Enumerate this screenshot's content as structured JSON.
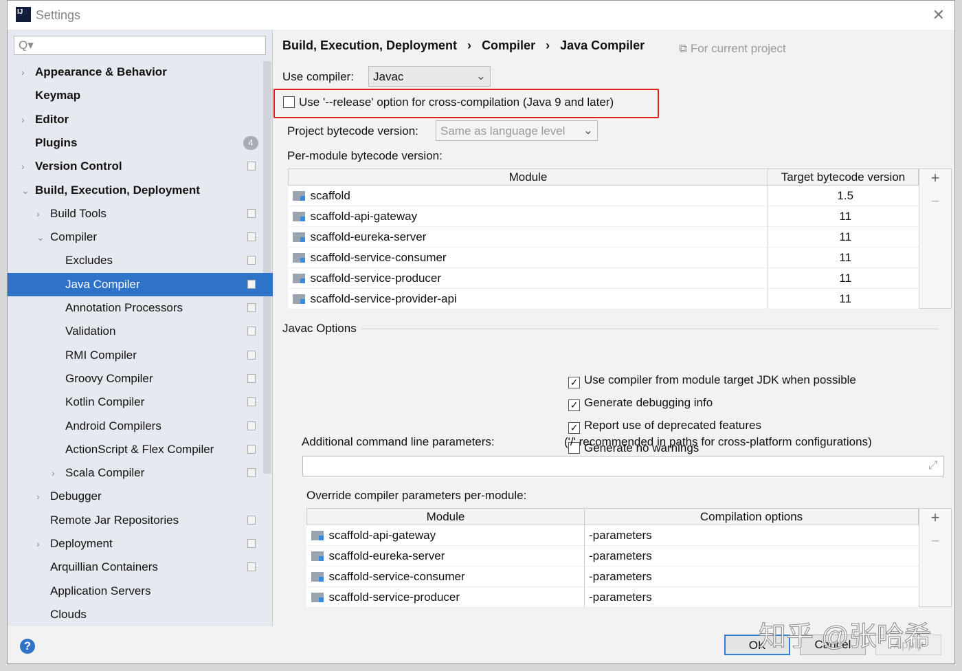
{
  "window": {
    "title": "Settings",
    "close": "✕"
  },
  "sidebar": {
    "search_placeholder": "Q▾",
    "items": [
      {
        "label": "Appearance & Behavior",
        "level": 0,
        "arrow": "›",
        "bold": true
      },
      {
        "label": "Keymap",
        "level": 0,
        "bold": true
      },
      {
        "label": "Editor",
        "level": 0,
        "arrow": "›",
        "bold": true
      },
      {
        "label": "Plugins",
        "level": 0,
        "bold": true,
        "badge": "4"
      },
      {
        "label": "Version Control",
        "level": 0,
        "arrow": "›",
        "bold": true,
        "icon": true
      },
      {
        "label": "Build, Execution, Deployment",
        "level": 0,
        "arrow": "⌄",
        "bold": true
      },
      {
        "label": "Build Tools",
        "level": 1,
        "arrow": "›",
        "icon": true
      },
      {
        "label": "Compiler",
        "level": 1,
        "arrow": "⌄",
        "icon": true
      },
      {
        "label": "Excludes",
        "level": 2,
        "icon": true
      },
      {
        "label": "Java Compiler",
        "level": 2,
        "icon": true,
        "selected": true
      },
      {
        "label": "Annotation Processors",
        "level": 2,
        "icon": true
      },
      {
        "label": "Validation",
        "level": 2,
        "icon": true
      },
      {
        "label": "RMI Compiler",
        "level": 2,
        "icon": true
      },
      {
        "label": "Groovy Compiler",
        "level": 2,
        "icon": true
      },
      {
        "label": "Kotlin Compiler",
        "level": 2,
        "icon": true
      },
      {
        "label": "Android Compilers",
        "level": 2,
        "icon": true
      },
      {
        "label": "ActionScript & Flex Compiler",
        "level": 2,
        "icon": true
      },
      {
        "label": "Scala Compiler",
        "level": 2,
        "arrow": "›",
        "icon": true
      },
      {
        "label": "Debugger",
        "level": 1,
        "arrow": "›"
      },
      {
        "label": "Remote Jar Repositories",
        "level": 1,
        "icon": true
      },
      {
        "label": "Deployment",
        "level": 1,
        "arrow": "›",
        "icon": true
      },
      {
        "label": "Arquillian Containers",
        "level": 1,
        "icon": true
      },
      {
        "label": "Application Servers",
        "level": 1
      },
      {
        "label": "Clouds",
        "level": 1
      }
    ]
  },
  "main": {
    "breadcrumb": [
      "Build, Execution, Deployment",
      "Compiler",
      "Java Compiler"
    ],
    "breadcrumb_sep": "›",
    "scope": "For current project",
    "use_compiler_label": "Use compiler:",
    "use_compiler_value": "Javac",
    "release_option": "Use '--release' option for cross-compilation (Java 9 and later)",
    "release_checked": false,
    "highlight_color": "#e02020",
    "bytecode_label": "Project bytecode version:",
    "bytecode_value": "Same as language level",
    "per_module_label": "Per-module bytecode version:",
    "module_table": {
      "headers": [
        "Module",
        "Target bytecode version"
      ],
      "rows": [
        [
          "scaffold",
          "1.5"
        ],
        [
          "scaffold-api-gateway",
          "11"
        ],
        [
          "scaffold-eureka-server",
          "11"
        ],
        [
          "scaffold-service-consumer",
          "11"
        ],
        [
          "scaffold-service-producer",
          "11"
        ],
        [
          "scaffold-service-provider-api",
          "11"
        ]
      ]
    },
    "javac_options_label": "Javac Options",
    "options": [
      {
        "label": "Use compiler from module target JDK when possible",
        "checked": true
      },
      {
        "label": "Generate debugging info",
        "checked": true
      },
      {
        "label": "Report use of deprecated features",
        "checked": true
      },
      {
        "label": "Generate no warnings",
        "checked": false
      }
    ],
    "additional_label": "Additional command line parameters:",
    "additional_hint": "('/' recommended in paths for cross-platform configurations)",
    "additional_value": "",
    "override_label": "Override compiler parameters per-module:",
    "override_table": {
      "headers": [
        "Module",
        "Compilation options"
      ],
      "rows": [
        [
          "scaffold-api-gateway",
          "-parameters"
        ],
        [
          "scaffold-eureka-server",
          "-parameters"
        ],
        [
          "scaffold-service-consumer",
          "-parameters"
        ],
        [
          "scaffold-service-producer",
          "-parameters"
        ]
      ]
    },
    "add": "+",
    "remove": "−"
  },
  "footer": {
    "help": "?",
    "ok": "OK",
    "cancel": "Cancel",
    "apply": "Apply"
  },
  "watermark": "知乎 @张哈希"
}
